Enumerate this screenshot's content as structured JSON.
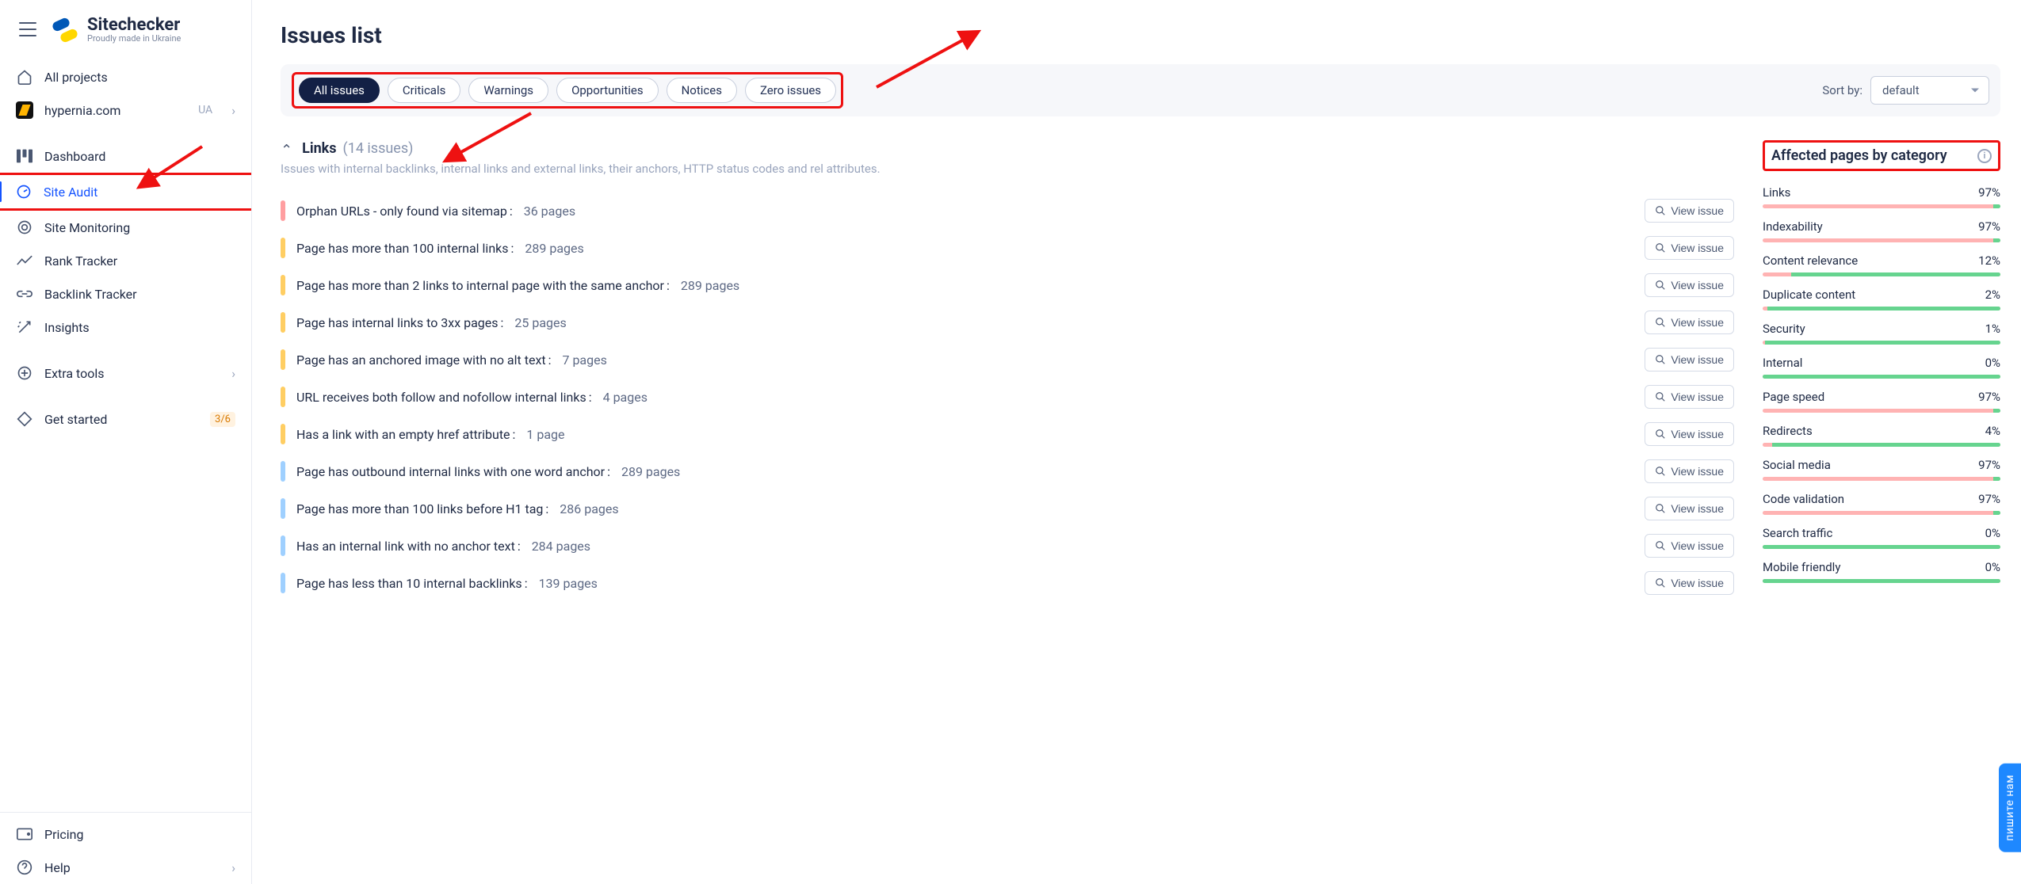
{
  "brand": {
    "name": "Sitechecker",
    "tagline": "Proudly made in Ukraine"
  },
  "sidebar": {
    "all_projects": "All projects",
    "project": {
      "name": "hypernia.com",
      "badge": "UA"
    },
    "nav": [
      {
        "key": "dashboard",
        "label": "Dashboard"
      },
      {
        "key": "site-audit",
        "label": "Site Audit"
      },
      {
        "key": "site-monitoring",
        "label": "Site Monitoring"
      },
      {
        "key": "rank-tracker",
        "label": "Rank Tracker"
      },
      {
        "key": "backlink-tracker",
        "label": "Backlink Tracker"
      },
      {
        "key": "insights",
        "label": "Insights"
      }
    ],
    "extra": "Extra tools",
    "getstarted": {
      "label": "Get started",
      "progress": "3/6"
    },
    "pricing": "Pricing",
    "help": "Help"
  },
  "page": {
    "title": "Issues list"
  },
  "filters": {
    "items": [
      "All issues",
      "Criticals",
      "Warnings",
      "Opportunities",
      "Notices",
      "Zero issues"
    ],
    "active": "All issues",
    "sort_label": "Sort by:",
    "sort_value": "default"
  },
  "group": {
    "name": "Links",
    "count_text": "(14 issues)",
    "desc": "Issues with internal backlinks, internal links and external links, their anchors, HTTP status codes and rel attributes."
  },
  "view_label": "View issue",
  "issues": [
    {
      "sev": "critical",
      "title": "Orphan URLs - only found via sitemap",
      "count": "36 pages"
    },
    {
      "sev": "warning",
      "title": "Page has more than 100 internal links",
      "count": "289 pages"
    },
    {
      "sev": "warning",
      "title": "Page has more than 2 links to internal page with the same anchor",
      "count": "289 pages"
    },
    {
      "sev": "warning",
      "title": "Page has internal links to 3xx pages",
      "count": "25 pages"
    },
    {
      "sev": "warning",
      "title": "Page has an anchored image with no alt text",
      "count": "7 pages"
    },
    {
      "sev": "warning",
      "title": "URL receives both follow and nofollow internal links",
      "count": "4 pages"
    },
    {
      "sev": "warning",
      "title": "Has a link with an empty href attribute",
      "count": "1 page"
    },
    {
      "sev": "notice",
      "title": "Page has outbound internal links with one word anchor",
      "count": "289 pages"
    },
    {
      "sev": "notice",
      "title": "Page has more than 100 links before H1 tag",
      "count": "286 pages"
    },
    {
      "sev": "notice",
      "title": "Has an internal link with no anchor text",
      "count": "284 pages"
    },
    {
      "sev": "notice",
      "title": "Page has less than 10 internal backlinks",
      "count": "139 pages"
    }
  ],
  "cats_title": "Affected pages by category",
  "categories": [
    {
      "name": "Links",
      "pct": "97%",
      "bad": 97
    },
    {
      "name": "Indexability",
      "pct": "97%",
      "bad": 97
    },
    {
      "name": "Content relevance",
      "pct": "12%",
      "bad": 12
    },
    {
      "name": "Duplicate content",
      "pct": "2%",
      "bad": 2
    },
    {
      "name": "Security",
      "pct": "1%",
      "bad": 1
    },
    {
      "name": "Internal",
      "pct": "0%",
      "bad": 0
    },
    {
      "name": "Page speed",
      "pct": "97%",
      "bad": 97
    },
    {
      "name": "Redirects",
      "pct": "4%",
      "bad": 4
    },
    {
      "name": "Social media",
      "pct": "97%",
      "bad": 97
    },
    {
      "name": "Code validation",
      "pct": "97%",
      "bad": 97
    },
    {
      "name": "Search traffic",
      "pct": "0%",
      "bad": 0
    },
    {
      "name": "Mobile friendly",
      "pct": "0%",
      "bad": 0
    }
  ],
  "chat_tab": "пишите нам"
}
